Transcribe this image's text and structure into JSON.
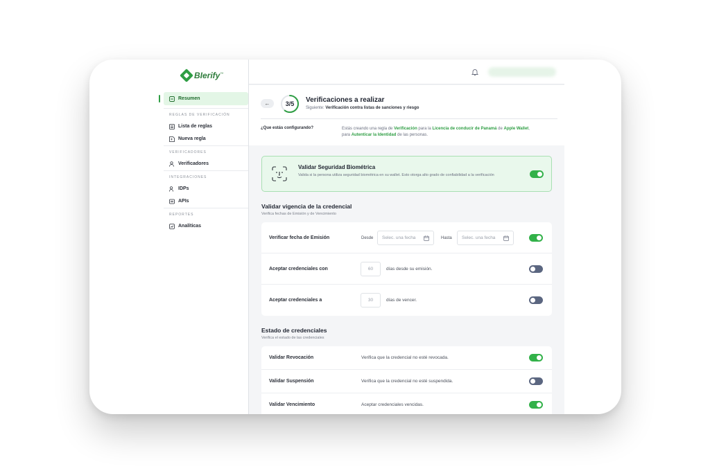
{
  "brand": {
    "name": "BIerify",
    "trademark": "™",
    "accent": "#2f9e44"
  },
  "sidebar": {
    "active": {
      "label": "Resumen",
      "icon": "summary-icon"
    },
    "sections": [
      {
        "title": "REGLAS DE VERIFICACIÓN",
        "items": [
          {
            "label": "Lista de reglas",
            "icon": "list-icon"
          },
          {
            "label": "Nueva regla",
            "icon": "new-rule-icon"
          }
        ]
      },
      {
        "title": "VERIFICADORES",
        "items": [
          {
            "label": "Verificadores",
            "icon": "users-icon"
          }
        ]
      },
      {
        "title": "INTEGRACIONES",
        "items": [
          {
            "label": "IDPs",
            "icon": "idp-icon"
          },
          {
            "label": "APIs",
            "icon": "api-icon"
          }
        ]
      },
      {
        "title": "REPORTES",
        "items": [
          {
            "label": "Analíticas",
            "icon": "analytics-icon"
          }
        ]
      }
    ]
  },
  "header": {
    "back_icon": "←",
    "step": "3/5",
    "step_progress": 0.6,
    "title": "Verificaciones a realizar",
    "subtitle_prefix": "Siguiente: ",
    "subtitle_next": "Verificación contra listas de sanciones y riesgo",
    "config_label": "¿Que estás configurando?",
    "config_text": {
      "t1": "Estás creando una regla de ",
      "h1": "Verificación",
      "t2": " para la ",
      "h2": "Licencia de conducir de Panamá",
      "t3": " de ",
      "h3": "Apple Wallet",
      "t4": ",",
      "t5": "para ",
      "h4": "Autenticar la Identidad",
      "t6": " de las personas."
    }
  },
  "biometric": {
    "title": "Validar Seguridad Biométrica",
    "description": "Valida si la persona utiliza seguridad biométrica en su wallet. Esto otorga alto grado de confiabilidad a la verificación",
    "enabled": true
  },
  "validity": {
    "title": "Validar vigencia de la credencial",
    "subtitle": "Verifica fechas de Emisión y de Vencimiento",
    "emission": {
      "label": "Verificar fecha de Emisión",
      "from_label": "Desde",
      "to_label": "Hasta",
      "from_placeholder": "Selec. una fecha",
      "to_placeholder": "Selec. una fecha",
      "enabled": true
    },
    "accept_since": {
      "label": "Aceptar credenciales con",
      "value": "60",
      "suffix": "días desde su emisión.",
      "enabled": false
    },
    "accept_expire": {
      "label": "Aceptar credenciales a",
      "value": "30",
      "suffix": "días de vencer.",
      "enabled": false
    }
  },
  "status": {
    "title": "Estado de credenciales",
    "subtitle": "Verifica el estado de las credenciales",
    "rows": [
      {
        "label": "Validar Revocación",
        "text": "Verifica que la credencial no esté revocada.",
        "enabled": true
      },
      {
        "label": "Validar Suspensión",
        "text": "Verifica que la credencial no esté suspendida.",
        "enabled": false
      },
      {
        "label": "Validar Vencimiento",
        "text": "Aceptar credenciales vencidas.",
        "enabled": true
      }
    ]
  }
}
